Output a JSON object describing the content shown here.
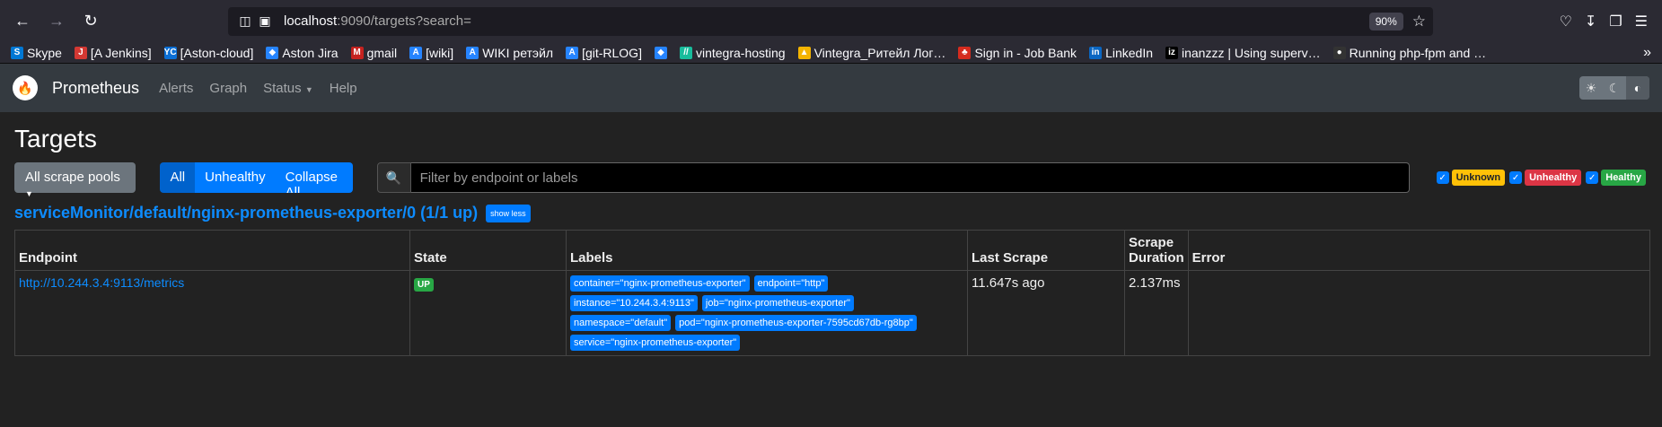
{
  "browser": {
    "url_host": "localhost",
    "url_rest": ":9090/targets?search=",
    "zoom": "90%",
    "bookmarks": [
      {
        "label": "Skype",
        "icon": "skype-icon",
        "color": "#0078d4",
        "glyph": "S"
      },
      {
        "label": "[A Jenkins]",
        "icon": "jenkins-icon",
        "color": "#d33833",
        "glyph": "J"
      },
      {
        "label": "[Aston-cloud]",
        "icon": "yc-icon",
        "color": "#0b6fd6",
        "glyph": "YC"
      },
      {
        "label": "Aston Jira",
        "icon": "jira-icon",
        "color": "#2684ff",
        "glyph": "◆"
      },
      {
        "label": "gmail",
        "icon": "gmail-icon",
        "color": "#c5221f",
        "glyph": "M"
      },
      {
        "label": "[wiki]",
        "icon": "confluence-icon",
        "color": "#2684ff",
        "glyph": "A"
      },
      {
        "label": "WIKI ретэйл",
        "icon": "confluence-icon",
        "color": "#2684ff",
        "glyph": "A"
      },
      {
        "label": "[git-RLOG]",
        "icon": "bitbucket-icon",
        "color": "#2684ff",
        "glyph": "A"
      },
      {
        "label": "",
        "icon": "jira-icon",
        "color": "#2684ff",
        "glyph": "◆"
      },
      {
        "label": "vintegra-hosting",
        "icon": "hosting-icon",
        "color": "#18bc9c",
        "glyph": "//"
      },
      {
        "label": "Vintegra_Ритейл Лог…",
        "icon": "drive-icon",
        "color": "#f4b400",
        "glyph": "▲"
      },
      {
        "label": "Sign in - Job Bank",
        "icon": "maple-leaf-icon",
        "color": "#d52b1e",
        "glyph": "♣"
      },
      {
        "label": "LinkedIn",
        "icon": "linkedin-icon",
        "color": "#0a66c2",
        "glyph": "in"
      },
      {
        "label": "inanzzz | Using superv…",
        "icon": "iz-icon",
        "color": "#000000",
        "glyph": "iz"
      },
      {
        "label": "Running php-fpm and …",
        "icon": "github-icon",
        "color": "#333333",
        "glyph": "●"
      }
    ]
  },
  "nav": {
    "brand": "Prometheus",
    "links": [
      "Alerts",
      "Graph",
      "Status",
      "Help"
    ]
  },
  "page": {
    "title": "Targets",
    "pool_selector": "All scrape pools",
    "filter_buttons": [
      "All",
      "Unhealthy",
      "Collapse All"
    ],
    "search_placeholder": "Filter by endpoint or labels",
    "health_filters": {
      "unknown": "Unknown",
      "unhealthy": "Unhealthy",
      "healthy": "Healthy"
    },
    "pool_name": "serviceMonitor/default/nginx-prometheus-exporter/0 (1/1 up)",
    "show_less": "show less"
  },
  "table": {
    "headers": {
      "endpoint": "Endpoint",
      "state": "State",
      "labels": "Labels",
      "last_scrape": "Last Scrape",
      "scrape_duration_1": "Scrape",
      "scrape_duration_2": "Duration",
      "error": "Error"
    },
    "row": {
      "endpoint": "http://10.244.3.4:9113/metrics",
      "state": "UP",
      "labels": [
        "container=\"nginx-prometheus-exporter\"",
        "endpoint=\"http\"",
        "instance=\"10.244.3.4:9113\"",
        "job=\"nginx-prometheus-exporter\"",
        "namespace=\"default\"",
        "pod=\"nginx-prometheus-exporter-7595cd67db-rg8bp\"",
        "service=\"nginx-prometheus-exporter\""
      ],
      "last_scrape": "11.647s ago",
      "scrape_duration": "2.137ms",
      "error": ""
    }
  }
}
